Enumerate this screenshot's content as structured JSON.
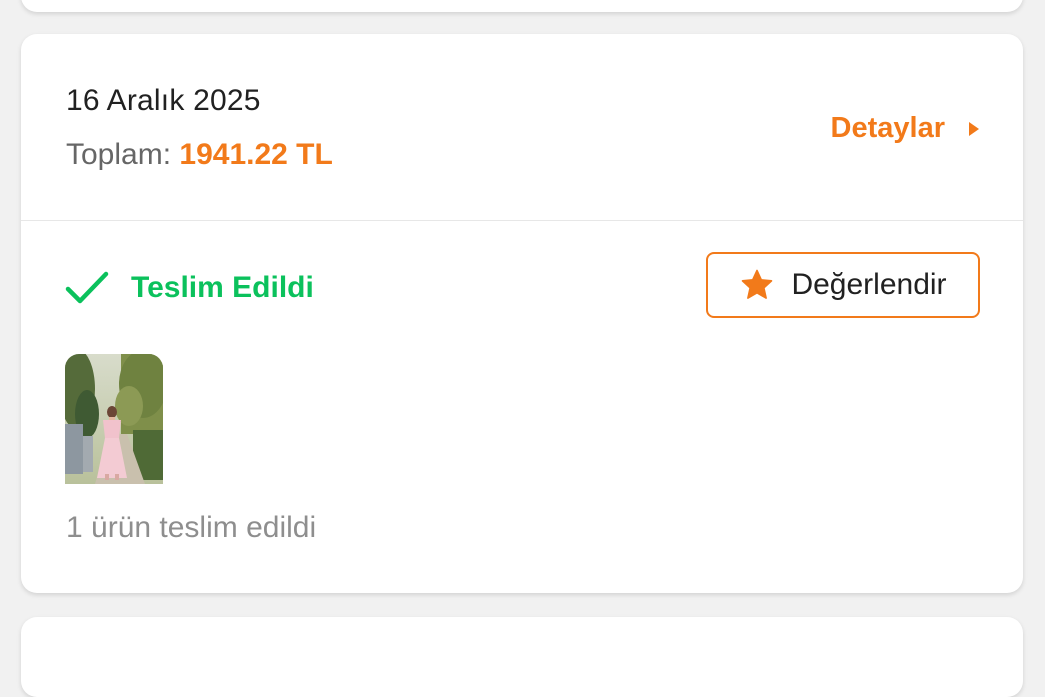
{
  "order": {
    "date": "16 Aralık 2025",
    "total_label": "Toplam:",
    "total_value": "1941.22 TL",
    "details_label": "Detaylar",
    "status_label": "Teslim Edildi",
    "rate_button_label": "Değerlendir",
    "delivered_count_text": "1 ürün teslim edildi"
  },
  "icons": {
    "details_arrow": "caret-right-icon",
    "status": "check-icon",
    "rate": "star-icon"
  },
  "colors": {
    "accent": "#f27a1a",
    "success": "#0bc15c",
    "text_primary": "#212121",
    "text_secondary": "#666666",
    "text_muted": "#8e8e8e",
    "background": "#f1f1f1",
    "card": "#ffffff"
  }
}
